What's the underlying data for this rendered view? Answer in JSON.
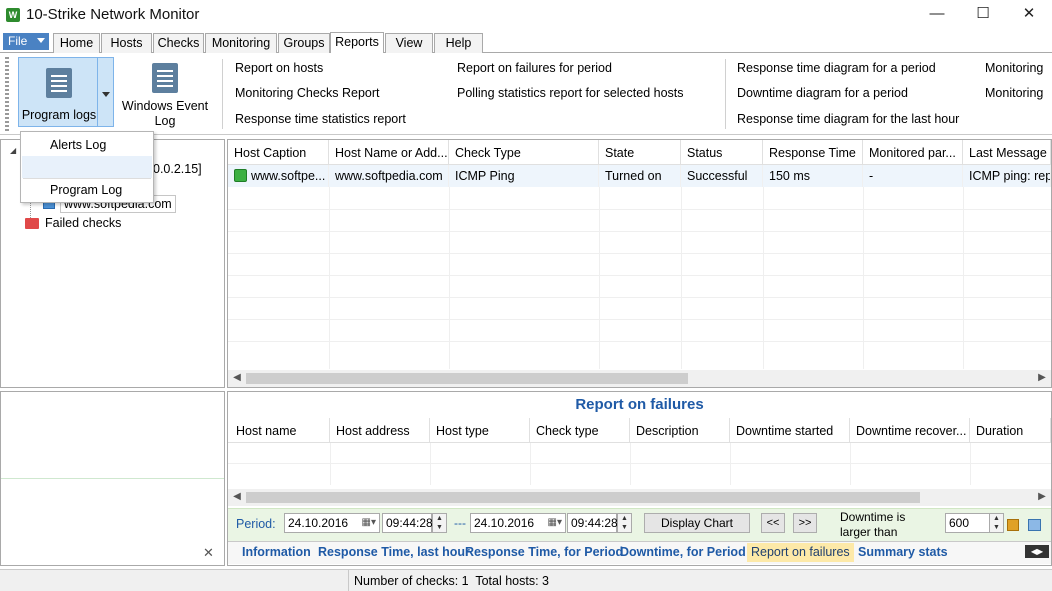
{
  "window": {
    "title": "10-Strike Network Monitor",
    "app_icon_text": "W",
    "minimize_glyph": "—",
    "maximize_glyph": "☐",
    "close_glyph": "✕"
  },
  "menu": {
    "file": "File",
    "tabs": [
      "Home",
      "Hosts",
      "Checks",
      "Monitoring",
      "Groups",
      "Reports",
      "View",
      "Help"
    ],
    "active_tab": "Reports"
  },
  "ribbon": {
    "program_logs": "Program logs",
    "windows_event_log": "Windows Event Log",
    "group1": [
      "Report on hosts",
      "Monitoring Checks Report",
      "Response time statistics report"
    ],
    "group2": [
      "Report on failures for period",
      "Polling statistics report for selected hosts"
    ],
    "group3": [
      "Response time diagram for a period",
      "Downtime diagram for a period",
      "Response time diagram for the last hour"
    ],
    "group4": [
      "Monitoring",
      "Monitoring"
    ]
  },
  "dropdown": {
    "items": [
      "Alerts Log",
      "Program Log"
    ]
  },
  "tree": {
    "partial_ip": "0.0.2.15]",
    "host": "www.softpedia.com",
    "failed_checks": "Failed checks",
    "expander": "◢"
  },
  "checks_table": {
    "columns": [
      "Host Caption",
      "Host Name or Add...",
      "Check Type",
      "State",
      "Status",
      "Response Time",
      "Monitored par...",
      "Last Message"
    ],
    "rows": [
      {
        "caption": "www.softpe...",
        "host": "www.softpedia.com",
        "check_type": "ICMP Ping",
        "state": "Turned on",
        "status": "Successful",
        "response_time": "150 ms",
        "monitored": "-",
        "last_message": "ICMP ping: repl"
      }
    ]
  },
  "report": {
    "title": "Report on failures",
    "columns": [
      "Host name",
      "Host address",
      "Host type",
      "Check type",
      "Description",
      "Downtime started",
      "Downtime recover...",
      "Duration"
    ],
    "period_label": "Period:",
    "date_from": "24.10.2016",
    "time_from": "09:44:28",
    "range_sep": "---",
    "date_to": "24.10.2016",
    "time_to": "09:44:28",
    "display_chart": "Display Chart",
    "prev": "<<",
    "next": ">>",
    "downtime_label_1": "Downtime is",
    "downtime_label_2": "larger than",
    "downtime_value": "600",
    "sheet_tabs": [
      "Information",
      "Response Time, last hour",
      "Response Time, for Period",
      "Downtime, for Period",
      "Report on failures",
      "Summary stats"
    ],
    "active_sheet": "Report on failures"
  },
  "status_bar": {
    "text": "Number of checks: 1  Total hosts: 3"
  },
  "misc": {
    "tray_close": "✕"
  }
}
